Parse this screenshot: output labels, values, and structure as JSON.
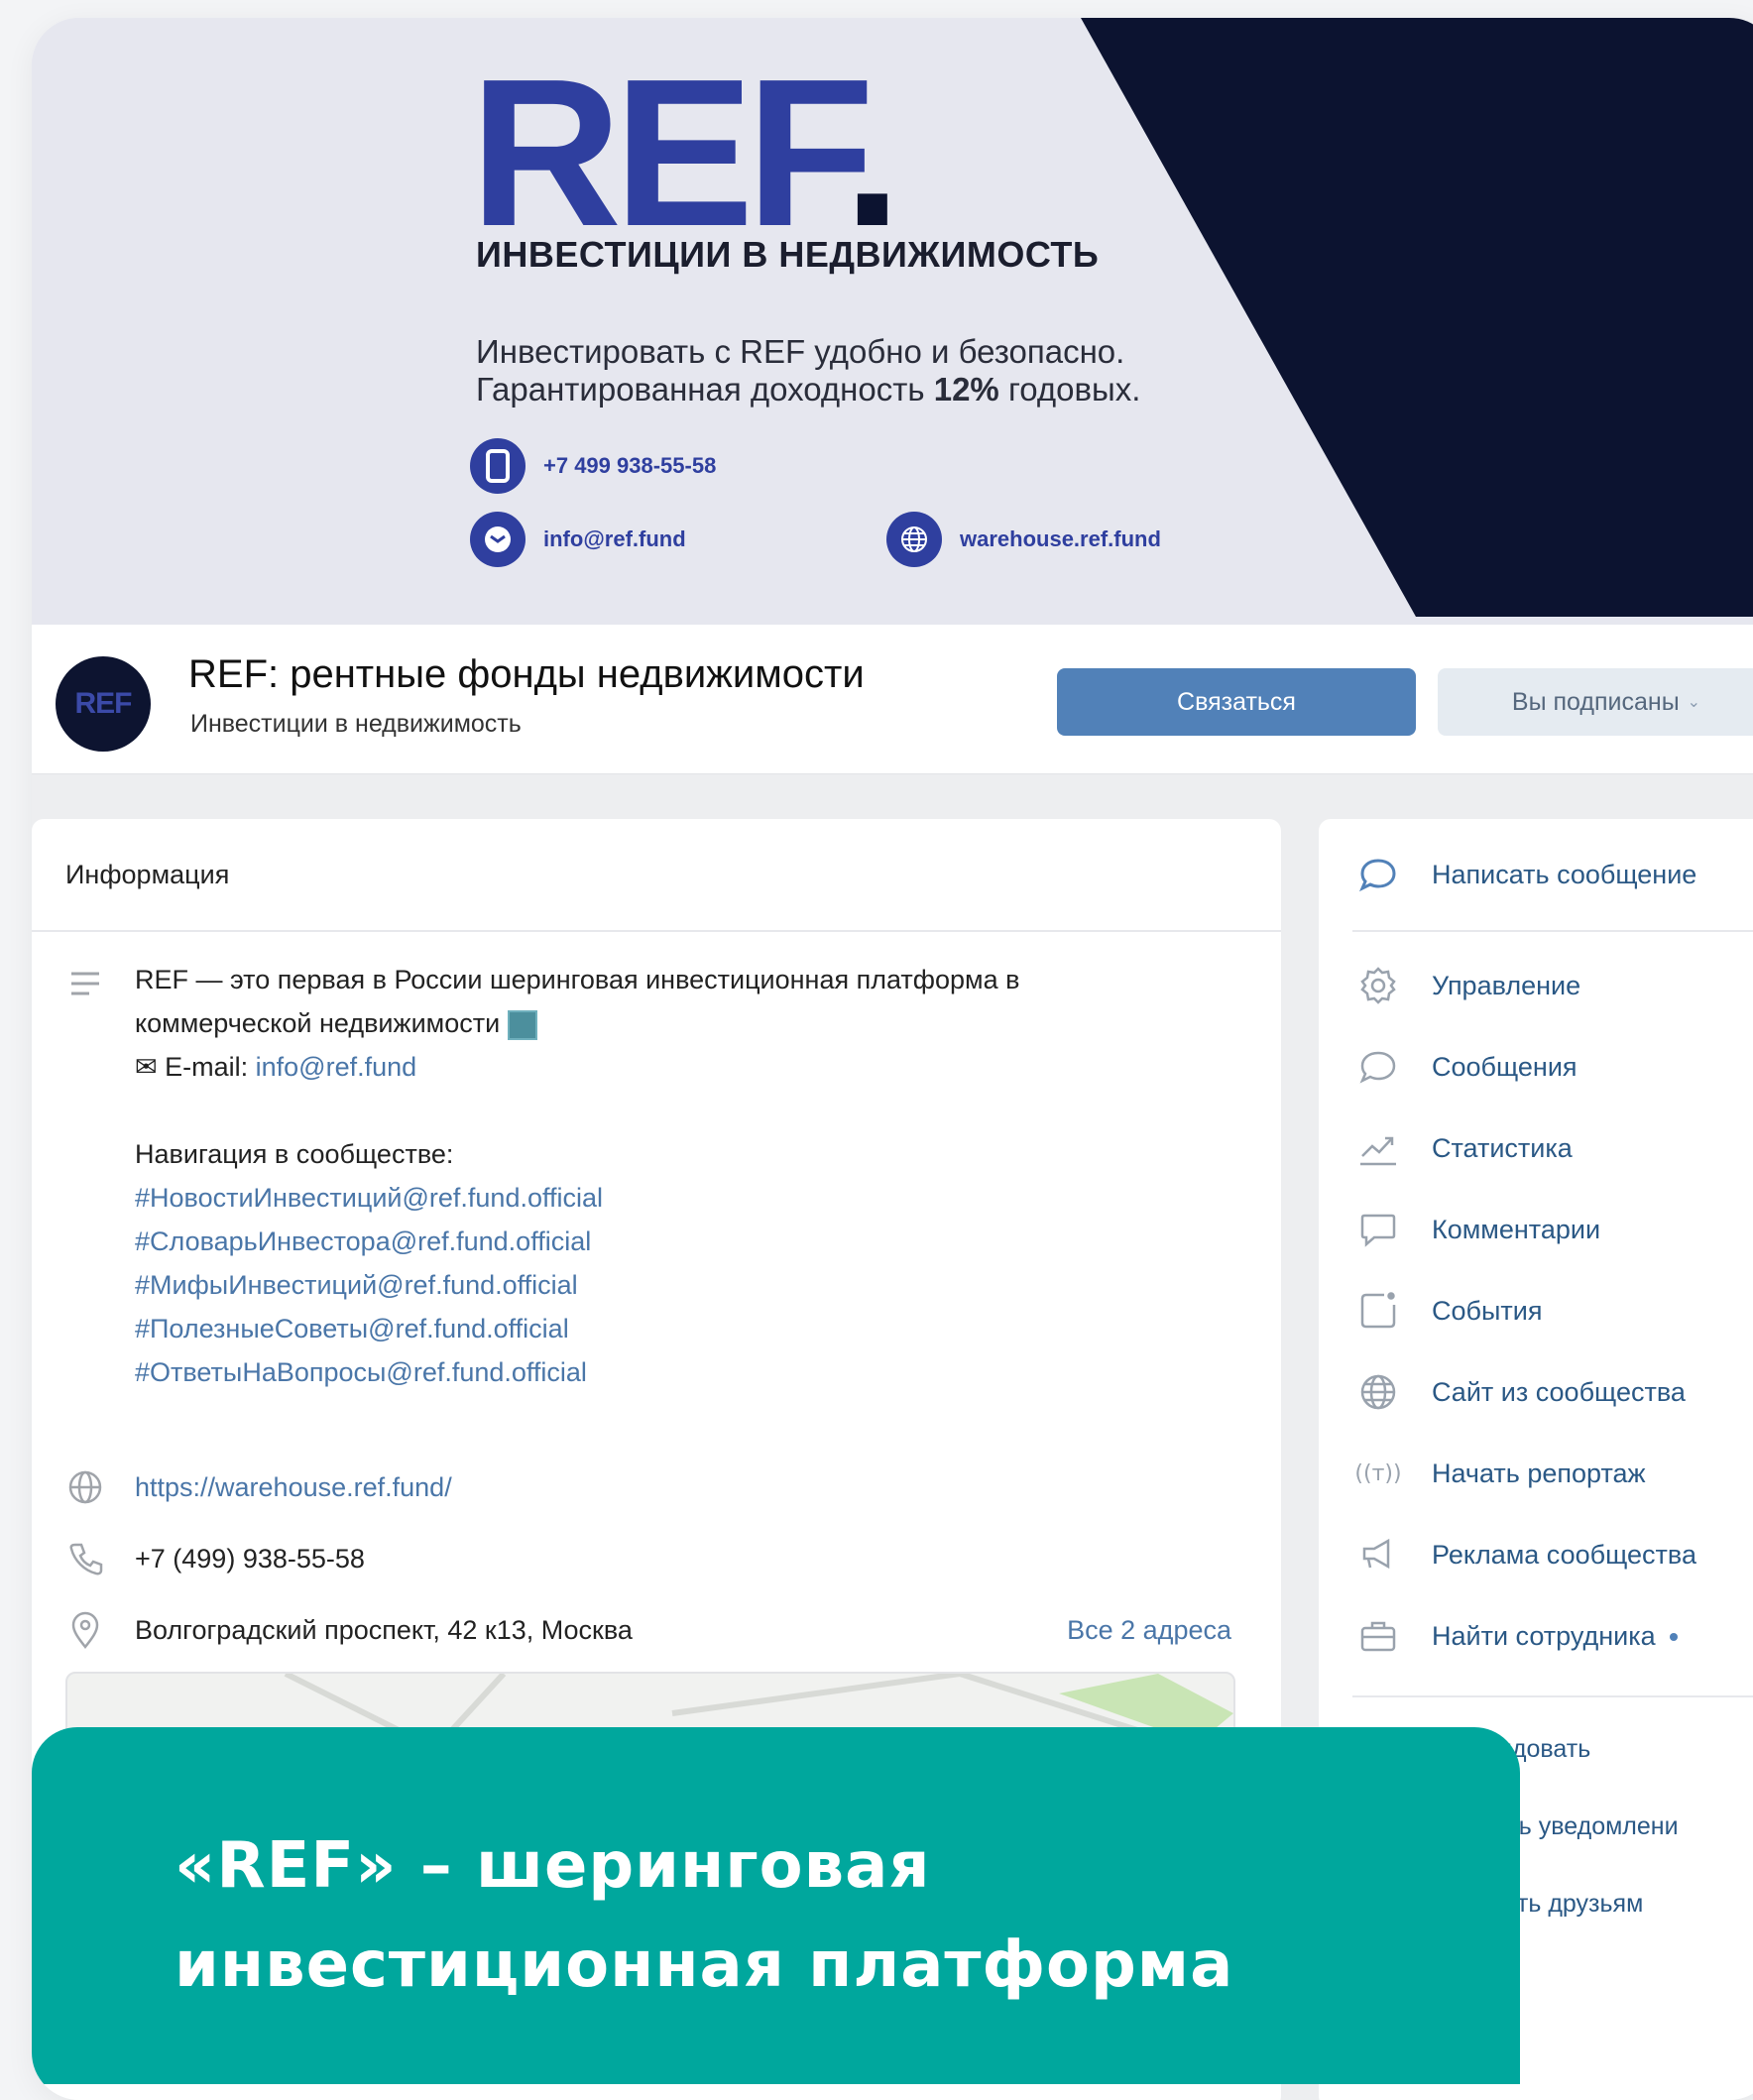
{
  "banner": {
    "logo": "REF",
    "logo_dot": ".",
    "title": "ИНВЕСТИЦИИ В НЕДВИЖИМОСТЬ",
    "subtitle_line1": "Инвестировать с REF удобно и безопасно.",
    "subtitle_line2_pre": "Гарантированная доходность ",
    "subtitle_line2_bold": "12%",
    "subtitle_line2_post": " годовых.",
    "phone": "+7 499 938-55-58",
    "email": "info@ref.fund",
    "site": "warehouse.ref.fund",
    "brand_color": "#2f3f9f",
    "dark_color": "#0c1330"
  },
  "header": {
    "avatar_text": "REF",
    "group_name": "REF: рентные фонды недвижимости",
    "group_subtitle": "Инвестиции в недвижимость",
    "contact_button": "Связаться",
    "subscribed_button": "Вы подписаны",
    "accent_color": "#5181b8"
  },
  "info": {
    "heading": "Информация",
    "description_line1": "REF — это первая в России шеринговая инвестиционная платформа в",
    "description_line2": "коммерческой недвижимости",
    "email_label": "✉ E-mail: ",
    "email_value": "info@ref.fund",
    "nav_title": "Навигация в сообществе:",
    "hashtags": [
      "#НовостиИнвестиций@ref.fund.official",
      "#СловарьИнвестора@ref.fund.official",
      "#МифыИнвестиций@ref.fund.official",
      "#ПолезныеСоветы@ref.fund.official",
      "#ОтветыНаВопросы@ref.fund.official"
    ],
    "website": "https://warehouse.ref.fund/",
    "phone": "+7 (499) 938-55-58",
    "address": "Волгоградский проспект, 42 к13, Москва",
    "all_addresses": "Все 2 адреса"
  },
  "menu": {
    "write_message": "Написать сообщение",
    "items": [
      {
        "label": "Управление",
        "icon": "gear-icon"
      },
      {
        "label": "Сообщения",
        "icon": "chat-icon"
      },
      {
        "label": "Статистика",
        "icon": "chart-icon"
      },
      {
        "label": "Комментарии",
        "icon": "comment-icon"
      },
      {
        "label": "События",
        "icon": "events-icon"
      },
      {
        "label": "Сайт из сообщества",
        "icon": "globe-icon"
      },
      {
        "label": "Начать репортаж",
        "icon": "broadcast-icon"
      },
      {
        "label": "Реклама сообщества",
        "icon": "megaphone-icon"
      },
      {
        "label": "Найти сотрудника",
        "icon": "briefcase-icon"
      }
    ],
    "partial_items": [
      "мендовать",
      "очить уведомлени",
      "казать друзьям"
    ]
  },
  "overlay": {
    "line1": "«REF» – шеринговая",
    "line2": "инвестиционная платформа",
    "color": "#00a79d"
  }
}
